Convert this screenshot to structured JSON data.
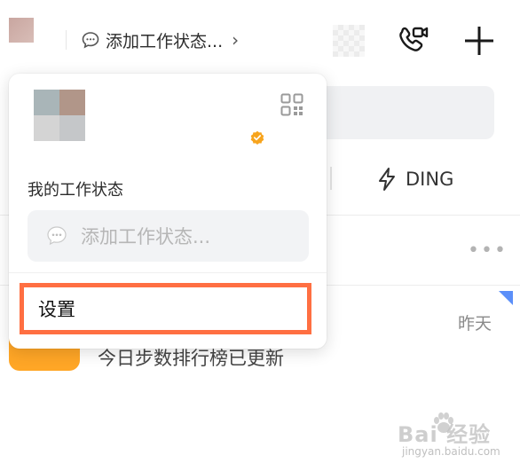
{
  "topbar": {
    "status_link_text": "添加工作状态...",
    "chevron": "›",
    "call_icon": "video-call-icon",
    "plus_icon": "plus-icon"
  },
  "background": {
    "ding_label": "DING",
    "more": "•••",
    "time_label": "昨天",
    "news_text": "今日步数排行榜已更新"
  },
  "popover": {
    "heading": "我的工作状态",
    "status_placeholder": "添加工作状态...",
    "settings_label": "设置",
    "qr_icon": "qr-code-icon",
    "verified_icon": "verified-badge-icon"
  },
  "watermark": {
    "logo_text": "Bai  经验",
    "url": "jingyan.baidu.com"
  },
  "colors": {
    "highlight": "#ff6f42",
    "verified": "#f7a41d",
    "orange_icon": "#ffa626",
    "unread_mark": "#5b8ff9"
  }
}
